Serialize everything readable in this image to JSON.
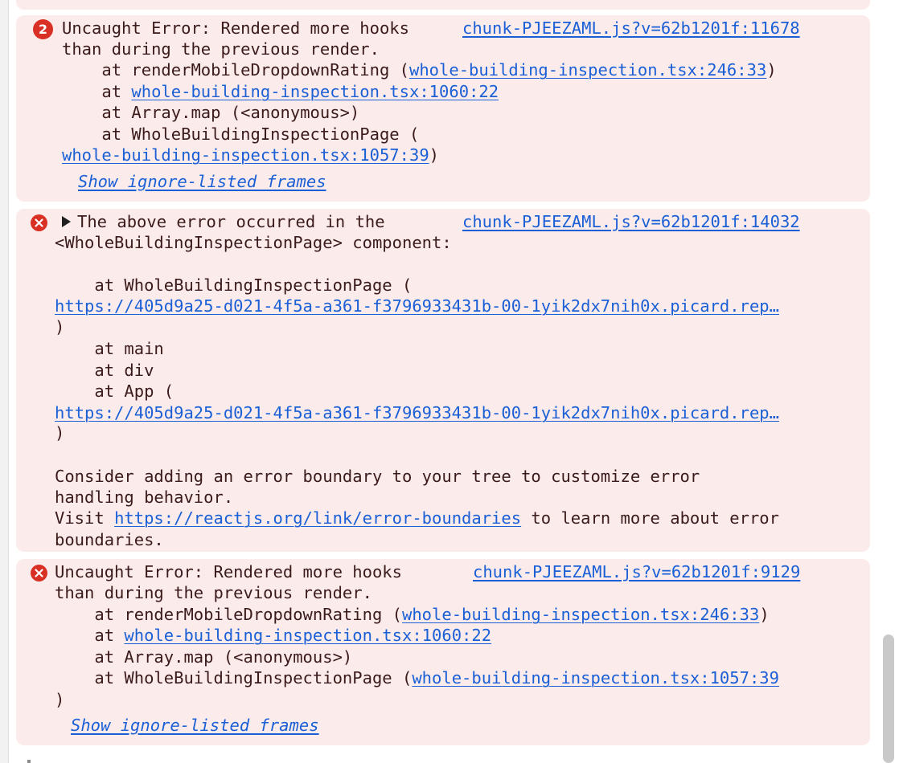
{
  "colors": {
    "message_background": "#fbeceb",
    "error_icon": "#d93025",
    "link": "#1a5fd6",
    "text": "#3a1a1a"
  },
  "messages": [
    {
      "icon": "error-count-badge",
      "count": "2",
      "source": "chunk-PJEEZAML.js?v=62b1201f:11678",
      "line1": "Uncaught Error: Rendered more hooks",
      "line2": "than during the previous render.",
      "stack": [
        {
          "prefix": "    at renderMobileDropdownRating (",
          "link": "whole-building-inspection.tsx:246:33",
          "suffix": ")"
        },
        {
          "prefix": "    at ",
          "link": "whole-building-inspection.tsx:1060:22",
          "suffix": ""
        },
        {
          "text": "    at Array.map (<anonymous>)"
        },
        {
          "text": "    at WholeBuildingInspectionPage ("
        },
        {
          "prefix": "",
          "link": "whole-building-inspection.tsx:1057:39",
          "suffix": ")"
        }
      ],
      "ignore_label": "Show ignore-listed frames"
    },
    {
      "icon": "error-x-icon",
      "source": "chunk-PJEEZAML.js?v=62b1201f:14032",
      "line1": "The above error occurred in the",
      "line2": "<WholeBuildingInspectionPage> component:",
      "stack": [
        {
          "text": "    at WholeBuildingInspectionPage ("
        },
        {
          "link": "https://405d9a25-d021-4f5a-a361-f3796933431b-00-1yik2dx7nih0x.picard.rep…"
        },
        {
          "text": ")"
        },
        {
          "text": "    at main"
        },
        {
          "text": "    at div"
        },
        {
          "text": "    at App ("
        },
        {
          "link": "https://405d9a25-d021-4f5a-a361-f3796933431b-00-1yik2dx7nih0x.picard.rep…"
        },
        {
          "text": ")"
        }
      ],
      "footer1": "Consider adding an error boundary to your tree to customize error",
      "footer2": "handling behavior.",
      "footer3_prefix": "Visit ",
      "footer3_link": "https://reactjs.org/link/error-boundaries",
      "footer3_suffix": " to learn more about error",
      "footer4": "boundaries."
    },
    {
      "icon": "error-x-icon",
      "source": "chunk-PJEEZAML.js?v=62b1201f:9129",
      "line1": "Uncaught Error: Rendered more hooks",
      "line2": "than during the previous render.",
      "stack": [
        {
          "prefix": "    at renderMobileDropdownRating (",
          "link": "whole-building-inspection.tsx:246:33",
          "suffix": ")"
        },
        {
          "prefix": "    at ",
          "link": "whole-building-inspection.tsx:1060:22",
          "suffix": ""
        },
        {
          "text": "    at Array.map (<anonymous>)"
        },
        {
          "prefix": "    at WholeBuildingInspectionPage (",
          "link": "whole-building-inspection.tsx:1057:39",
          "suffix": ""
        },
        {
          "text": ")"
        }
      ],
      "ignore_label": "Show ignore-listed frames"
    }
  ]
}
